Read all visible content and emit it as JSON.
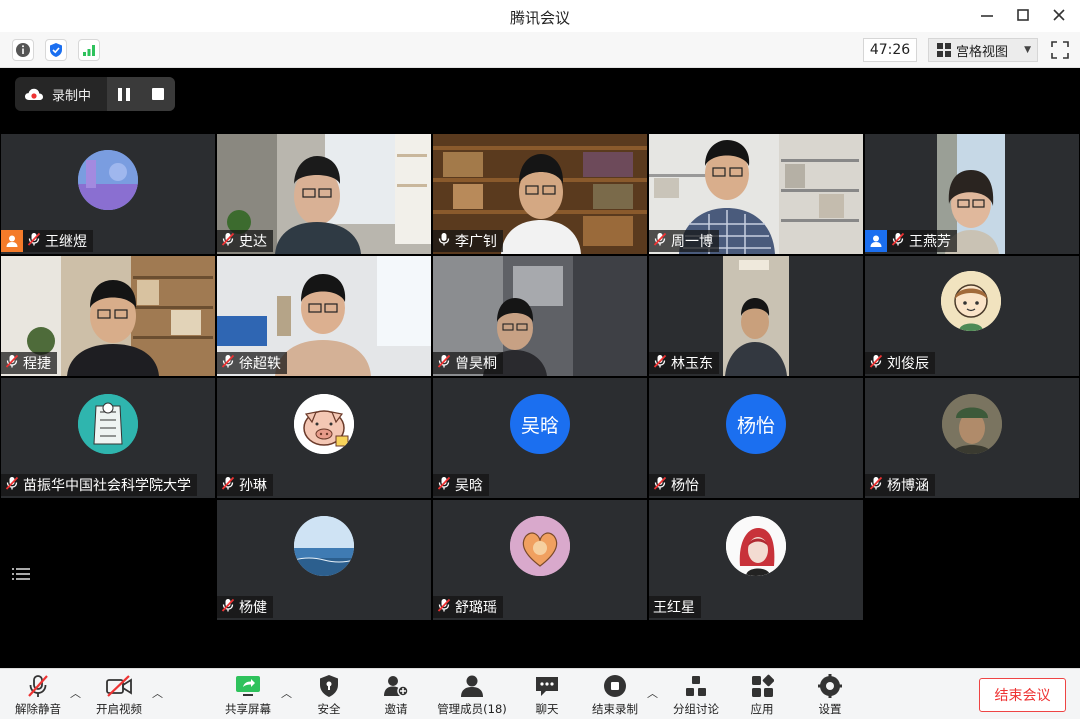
{
  "window": {
    "title": "腾讯会议"
  },
  "infobar": {
    "timer": "47:26",
    "view_mode": "宫格视图"
  },
  "recording": {
    "label": "录制中"
  },
  "participants": [
    {
      "name": "王继煜",
      "host": true
    },
    {
      "name": "史达"
    },
    {
      "name": "李广钊",
      "speaking": true
    },
    {
      "name": "周一博"
    },
    {
      "name": "王燕芳",
      "host": true
    },
    {
      "name": "程捷"
    },
    {
      "name": "徐超轶"
    },
    {
      "name": "曾昊桐"
    },
    {
      "name": "林玉东"
    },
    {
      "name": "刘俊辰"
    },
    {
      "name": "苗振华中国社会科学院大学"
    },
    {
      "name": "孙琳"
    },
    {
      "name": "吴晗",
      "initials": "吴晗"
    },
    {
      "name": "杨怡",
      "initials": "杨怡"
    },
    {
      "name": "杨博涵"
    },
    {
      "name": "杨健"
    },
    {
      "name": "舒璐瑶"
    },
    {
      "name": "王红星"
    }
  ],
  "toolbar": {
    "unmute": "解除静音",
    "start_video": "开启视频",
    "share_screen": "共享屏幕",
    "security": "安全",
    "invite": "邀请",
    "manage_members": "管理成员(18)",
    "chat": "聊天",
    "stop_recording": "结束录制",
    "breakout": "分组讨论",
    "apps": "应用",
    "settings": "设置",
    "end_meeting": "结束会议"
  },
  "colors": {
    "accent_blue": "#1b6ff0",
    "speaking_green": "#2ec25c",
    "end_red": "#e33333",
    "host_badge": "#f47b2a"
  }
}
